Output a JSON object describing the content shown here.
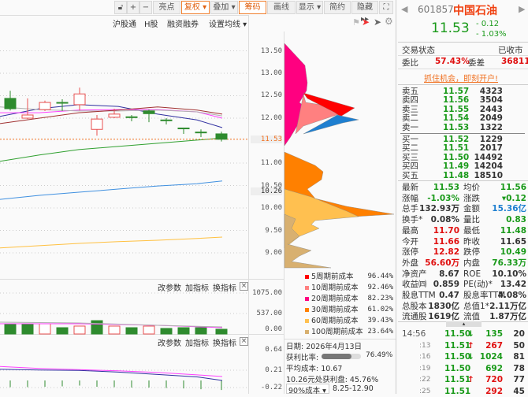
{
  "toolbar": {
    "buttons": [
      {
        "label": "亮点"
      },
      {
        "label": "复权 ▾",
        "active": true
      },
      {
        "label": "叠加 ▾"
      },
      {
        "label": "筹码",
        "active": true
      },
      {
        "label": "画线"
      },
      {
        "label": "显示 ▾"
      },
      {
        "label": "简约"
      },
      {
        "label": "隐藏 ▸▸"
      }
    ],
    "unlock_icon": "unlock-icon",
    "plus": "+",
    "minus": "−",
    "fullscreen_icon": "⛶"
  },
  "subbar": {
    "items": [
      "沪股通",
      "H股",
      "融资融券",
      "设置均线 ▾"
    ]
  },
  "price_axis": {
    "ticks": [
      "13.50",
      "13.00",
      "12.50",
      "12.00",
      "11.00",
      "10.50",
      "10.00",
      "9.50",
      "9.00"
    ],
    "current": "11.53",
    "cursor": "10.26"
  },
  "pane_tools": {
    "edit": "改参数",
    "add": "加指标",
    "swap": "换指标",
    "close": "×"
  },
  "volume_axis": [
    "1075.00",
    "537.00",
    "0.00"
  ],
  "macd_axis": [
    "0.64",
    "0.21",
    "-0.22"
  ],
  "colors": {
    "up": "#e85050",
    "down": "#2e8b2e",
    "accent": "#f07020"
  },
  "chart_data": {
    "type": "candlestick",
    "candles": [
      {
        "o": 12.44,
        "c": 12.21,
        "h": 12.61,
        "l": 12.17
      },
      {
        "o": 12.0,
        "c": 12.07,
        "h": 12.44,
        "l": 11.98
      },
      {
        "o": 12.19,
        "c": 12.35,
        "h": 12.39,
        "l": 12.16
      },
      {
        "o": 12.35,
        "c": 12.34,
        "h": 12.42,
        "l": 12.16
      },
      {
        "o": 12.3,
        "c": 12.54,
        "h": 12.68,
        "l": 12.17
      },
      {
        "o": 11.75,
        "c": 11.98,
        "h": 12.07,
        "l": 11.61
      },
      {
        "o": 12.02,
        "c": 12.09,
        "h": 12.21,
        "l": 12.0
      },
      {
        "o": 12.03,
        "c": 12.02,
        "h": 12.07,
        "l": 11.93
      },
      {
        "o": 12.16,
        "c": 12.1,
        "h": 12.19,
        "l": 11.91
      },
      {
        "o": 11.96,
        "c": 11.95,
        "h": 12.0,
        "l": 11.86
      },
      {
        "o": 11.78,
        "c": 11.77,
        "h": 11.79,
        "l": 11.65
      },
      {
        "o": 11.69,
        "c": 11.68,
        "h": 11.75,
        "l": 11.58
      },
      {
        "o": 11.65,
        "c": 11.53,
        "h": 11.7,
        "l": 11.48
      }
    ],
    "ma": [
      {
        "color": "#3030a0",
        "values": [
          12.04,
          12.21,
          12.3,
          12.26,
          12.09,
          11.96,
          11.79
        ]
      },
      {
        "color": "#ff40ff",
        "values": [
          12.12,
          12.12,
          12.18,
          12.19,
          12.19,
          12.14,
          12.0
        ]
      },
      {
        "color": "#b0b0b0",
        "values": [
          12.25,
          12.19,
          12.16,
          12.16,
          12.18,
          12.14,
          12.05
        ]
      },
      {
        "color": "#a03030",
        "values": [
          11.88,
          12.0,
          12.12,
          12.18,
          12.25,
          12.18,
          12.09
        ]
      },
      {
        "color": "#30a030",
        "values": [
          11.04,
          11.18,
          11.3,
          11.37,
          11.44,
          11.51,
          11.56
        ]
      },
      {
        "color": "#4090e0",
        "values": [
          10.19,
          10.28,
          10.35,
          10.42,
          10.49,
          10.54,
          10.6
        ]
      },
      {
        "color": "#ffc040",
        "values": [
          9.11,
          9.16,
          9.21,
          9.25,
          9.28,
          9.32,
          9.35
        ]
      }
    ],
    "volume": [
      248,
      248,
      268,
      165,
      207,
      350,
      207,
      165,
      207,
      145,
      165,
      165,
      124
    ],
    "volume_up": [
      false,
      false,
      true,
      false,
      true,
      false,
      true,
      false,
      true,
      false,
      false,
      false,
      false
    ],
    "macd_bars": [
      -0.05,
      -0.05,
      -0.04,
      -0.03,
      -0.01,
      -0.04,
      -0.05,
      -0.06,
      -0.06,
      -0.07,
      -0.08,
      -0.1,
      -0.12
    ],
    "dif": [
      0.31,
      0.26,
      0.23,
      0.2,
      0.16,
      0.1,
      0.06
    ],
    "dea": [
      0.24,
      0.22,
      0.21,
      0.17,
      0.11,
      0.05,
      -0.04
    ]
  },
  "quote": {
    "code": "601857",
    "name": "中国石油",
    "price": "11.53",
    "change": "- 0.12",
    "change_pct": "- 1.03%",
    "status_label": "交易状态",
    "status": "已收市",
    "wb_label": "委比",
    "wb": "57.43%",
    "wc_label": "委差",
    "wc": "36811",
    "promo": "抓住机会，即刻开户!"
  },
  "order_book": {
    "asks": [
      {
        "label": "卖五",
        "price": "11.57",
        "vol": "4323"
      },
      {
        "label": "卖四",
        "price": "11.56",
        "vol": "3504"
      },
      {
        "label": "卖三",
        "price": "11.55",
        "vol": "2443"
      },
      {
        "label": "卖二",
        "price": "11.54",
        "vol": "2049"
      },
      {
        "label": "卖一",
        "price": "11.53",
        "vol": "1322"
      }
    ],
    "bids": [
      {
        "label": "买一",
        "price": "11.52",
        "vol": "1229"
      },
      {
        "label": "买二",
        "price": "11.51",
        "vol": "2017"
      },
      {
        "label": "买三",
        "price": "11.50",
        "vol": "14492"
      },
      {
        "label": "买四",
        "price": "11.49",
        "vol": "14204"
      },
      {
        "label": "买五",
        "price": "11.48",
        "vol": "18510"
      }
    ]
  },
  "stats": [
    {
      "l1": "最新",
      "v1": "11.53",
      "c1": "g",
      "l2": "均价",
      "v2": "11.56",
      "c2": "g"
    },
    {
      "l1": "涨幅",
      "v1": "-1.03%",
      "c1": "g",
      "l2": "涨跌",
      "v2": "▾0.12",
      "c2": "g"
    },
    {
      "l1": "总手",
      "v1": "132.93万",
      "c1": "k",
      "l2": "金额",
      "v2": "15.36亿",
      "c2": "b"
    },
    {
      "l1": "换手*",
      "v1": "0.08%",
      "c1": "k",
      "l2": "量比",
      "v2": "0.83",
      "c2": "g"
    },
    {
      "l1": "最高",
      "v1": "11.70",
      "c1": "r",
      "l2": "最低",
      "v2": "11.48",
      "c2": "g"
    },
    {
      "l1": "今开",
      "v1": "11.66",
      "c1": "r",
      "l2": "昨收",
      "v2": "11.65",
      "c2": "k"
    },
    {
      "l1": "涨停",
      "v1": "12.82",
      "c1": "r",
      "l2": "跌停",
      "v2": "10.49",
      "c2": "g"
    },
    {
      "l1": "外盘",
      "v1": "56.60万",
      "c1": "r",
      "l2": "内盘",
      "v2": "76.33万",
      "c2": "g"
    },
    {
      "l1": "净资产",
      "v1": "8.67",
      "c1": "k",
      "l2": "ROE",
      "v2": "10.10%",
      "c2": "k"
    },
    {
      "l1": "收益㈣",
      "v1": "0.859",
      "c1": "k",
      "l2": "PE(动)*",
      "v2": "13.42",
      "c2": "k"
    },
    {
      "l1": "股息TTM",
      "v1": "0.47",
      "c1": "k",
      "l2": "股息率TTM",
      "v2": "4.08%",
      "c2": "k"
    },
    {
      "l1": "总股本",
      "v1": "1830亿",
      "c1": "k",
      "l2": "总值1*",
      "v2": "2.11万亿",
      "c2": "k"
    },
    {
      "l1": "流通股",
      "v1": "1619亿",
      "c1": "k",
      "l2": "流值",
      "v2": "1.87万亿",
      "c2": "k"
    }
  ],
  "ticks": [
    {
      "time": "14:56",
      "price": "11.50",
      "dir": "↓",
      "vol": "135",
      "vc": "g",
      "n": "20"
    },
    {
      "time": ":13",
      "price": "11.51",
      "dir": "↑",
      "vol": "267",
      "vc": "r",
      "n": "50"
    },
    {
      "time": ":16",
      "price": "11.50",
      "dir": "↓",
      "vol": "1024",
      "vc": "g",
      "n": "81"
    },
    {
      "time": ":19",
      "price": "11.50",
      "dir": "",
      "vol": "692",
      "vc": "g",
      "n": "78"
    },
    {
      "time": ":22",
      "price": "11.51",
      "dir": "↑",
      "vol": "720",
      "vc": "r",
      "n": "77"
    },
    {
      "time": ":25",
      "price": "11.51",
      "dir": "",
      "vol": "292",
      "vc": "r",
      "n": "45"
    }
  ],
  "chips": {
    "legend": [
      {
        "label": "5周期前成本",
        "pct": "96.44%",
        "color": "#ff0000"
      },
      {
        "label": "10周期前成本",
        "pct": "92.46%",
        "color": "#ff8080"
      },
      {
        "label": "20周期前成本",
        "pct": "82.23%",
        "color": "#ff0080"
      },
      {
        "label": "30周期前成本",
        "pct": "61.02%",
        "color": "#ff8000"
      },
      {
        "label": "60周期前成本",
        "pct": "39.43%",
        "color": "#ffc050"
      },
      {
        "label": "100周期前成本",
        "pct": "23.64%",
        "color": "#d8b070"
      }
    ],
    "date": "日期: 2026年4月13日",
    "profit_label": "获利比率:",
    "profit_ratio": 0.7649,
    "profit_text": "76.49%",
    "avg_cost": "平均成本: 10.67",
    "profit_at": "10.26元处获利盘: 45.76%",
    "range_select": "90%成本 ▾",
    "range": "8.25-12.90"
  }
}
